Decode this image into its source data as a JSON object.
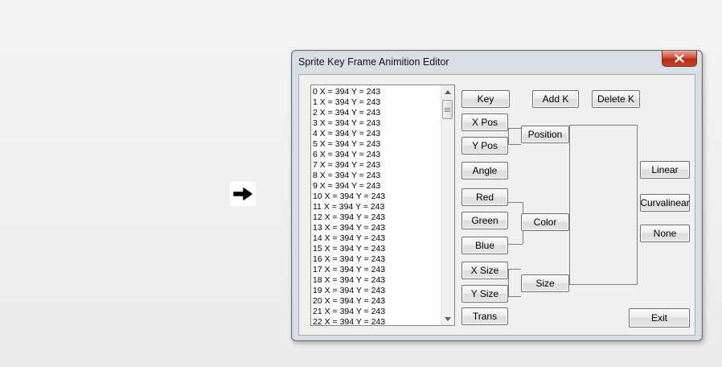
{
  "window": {
    "title": "Sprite Key Frame  Animition Editor",
    "close_label": "✕"
  },
  "list": {
    "items": [
      "0 X = 394 Y = 243",
      "1 X = 394 Y = 243",
      "2 X = 394 Y = 243",
      "3 X = 394 Y = 243",
      "4 X = 394 Y = 243",
      "5 X = 394 Y = 243",
      "6 X = 394 Y = 243",
      "7 X = 394 Y = 243",
      "8 X = 394 Y = 243",
      "9 X = 394 Y = 243",
      "10 X = 394 Y = 243",
      "11 X = 394 Y = 243",
      "12 X = 394 Y = 243",
      "13 X = 394 Y = 243",
      "14 X = 394 Y = 243",
      "15 X = 394 Y = 243",
      "16 X = 394 Y = 243",
      "17 X = 394 Y = 243",
      "18 X = 394 Y = 243",
      "19 X = 394 Y = 243",
      "20 X = 394 Y = 243",
      "21 X = 394 Y = 243",
      "22 X = 394 Y = 243"
    ]
  },
  "buttons": {
    "key": "Key",
    "add_k": "Add K",
    "delete_k": "Delete K",
    "x_pos": "X Pos",
    "y_pos": "Y Pos",
    "position": "Position",
    "angle": "Angle",
    "red": "Red",
    "green": "Green",
    "blue": "Blue",
    "color": "Color",
    "x_size": "X Size",
    "y_size": "Y Size",
    "size": "Size",
    "trans": "Trans",
    "linear": "Linear",
    "curvalinear": "Curvalinear",
    "none": "None",
    "exit": "Exit"
  },
  "icons": {
    "desktop_arrow": "right-arrow-icon",
    "close": "close-icon"
  },
  "colors": {
    "close_red": "#c8402a",
    "frame": "#d9dfe7",
    "client": "#f0f0f0"
  }
}
